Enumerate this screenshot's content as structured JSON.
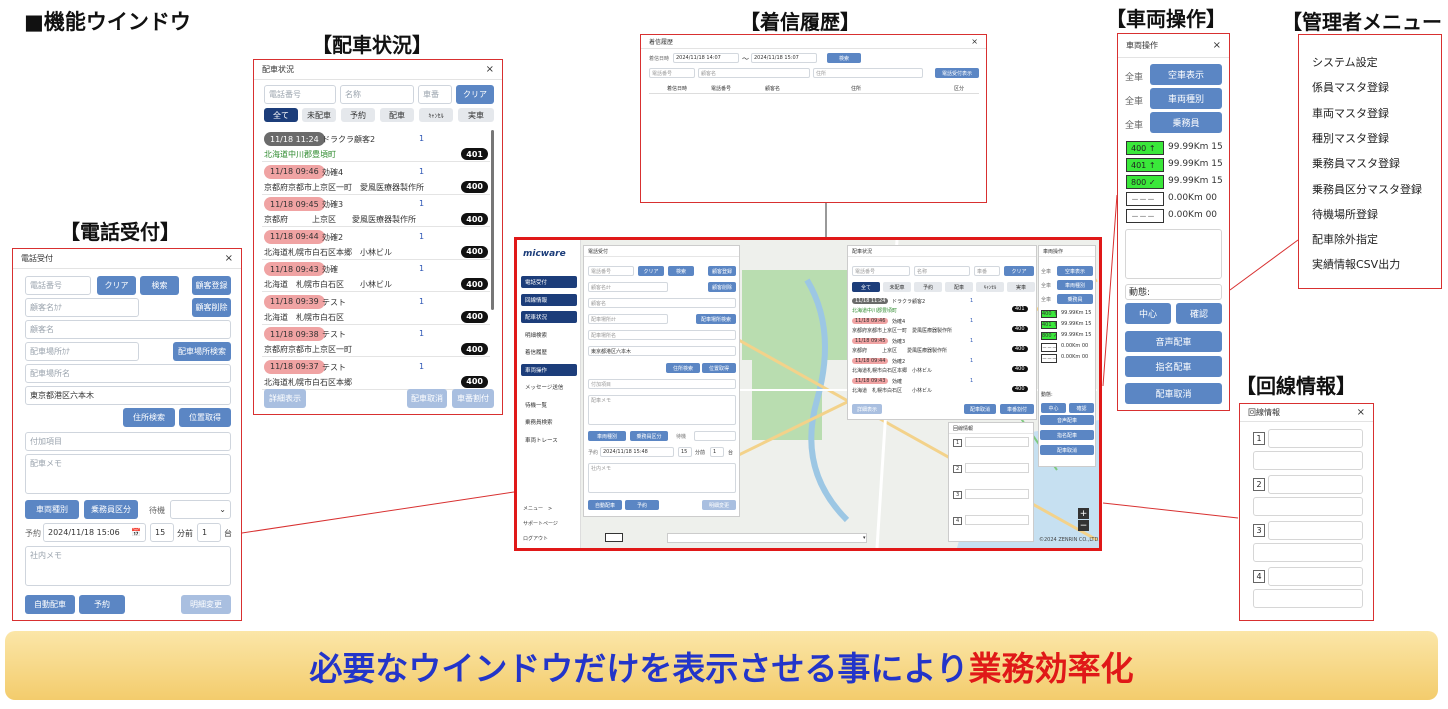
{
  "headline": "■機能ウインドウ",
  "callouts": {
    "haisha": "【配車状況】",
    "chakushin": "【着信履歴】",
    "sharyou": "【車両操作】",
    "kanri": "【管理者メニュー",
    "denwa": "【電話受付】",
    "kaisen": "【回線情報】"
  },
  "denwa": {
    "title": "電話受付",
    "close": "×",
    "phone_ph": "電話番号",
    "clear": "クリア",
    "search": "検索",
    "cust_reg": "顧客登録",
    "cust_kana_ph": "顧客名ｶﾅ",
    "cust_del": "顧客削除",
    "cust_name_ph": "顧客名",
    "place_kana_ph": "配車場所ｶﾅ",
    "place_search": "配車場所検索",
    "place_name_ph": "配車場所名",
    "address": "東京都港区六本木",
    "addr_search": "住所検索",
    "pos_get": "位置取得",
    "extra_ph": "付加項目",
    "memo_ph": "配車メモ",
    "vehicle_type": "車両種別",
    "crew_class": "乗務員区分",
    "wait_label": "待機",
    "reserve_label": "予約",
    "reserve_dt": "2024/11/18 15:06",
    "cal_icon": "📅",
    "minutes": "15",
    "min_before": "分前",
    "count": "1",
    "unit": "台",
    "internal_memo_ph": "社内メモ",
    "auto": "自動配車",
    "reserve": "予約",
    "change": "明細変更"
  },
  "haisha": {
    "title": "配車状況",
    "close": "×",
    "phone_ph": "電話番号",
    "name_ph": "名称",
    "car_ph": "車番",
    "clear": "クリア",
    "tabs": [
      "全て",
      "未配車",
      "予約",
      "配車",
      "ｷｬﾝｾﾙ",
      "実車"
    ],
    "rows": [
      {
        "time": "11/18 11:24",
        "name": "ドラクラ顧客2",
        "num": "1",
        "addr": "北海道中川郡豊頃町",
        "badge": "401"
      },
      {
        "time": "11/18 09:46",
        "name": "効確4",
        "num": "1",
        "addr": "京都府京都市上京区一町　愛風医療器製作所",
        "badge": "400"
      },
      {
        "time": "11/18 09:45",
        "name": "効確3",
        "num": "1",
        "addr": "京都府　　　上京区　　愛風医療器製作所",
        "badge": "400"
      },
      {
        "time": "11/18 09:44",
        "name": "効確2",
        "num": "1",
        "addr": "北海道札幌市白石区本郷　小林ビル",
        "badge": "400"
      },
      {
        "time": "11/18 09:43",
        "name": "効確",
        "num": "1",
        "addr": "北海道　札幌市白石区　　小林ビル",
        "badge": "400"
      },
      {
        "time": "11/18 09:39",
        "name": "テスト",
        "num": "1",
        "addr": "北海道　札幌市白石区",
        "badge": "400"
      },
      {
        "time": "11/18 09:38",
        "name": "テスト",
        "num": "1",
        "addr": "京都府京都市上京区一町",
        "badge": "400"
      },
      {
        "time": "11/18 09:37",
        "name": "テスト",
        "num": "1",
        "addr": "北海道札幌市白石区本郷",
        "badge": "400"
      }
    ],
    "detail": "詳細表示",
    "cancel": "配車取消",
    "assign": "車番割付"
  },
  "chakushin": {
    "title": "着信履歴",
    "close": "×",
    "date_label": "着信日時",
    "from": "2024/11/18 14:07",
    "tilde": "〜",
    "to": "2024/11/18 15:07",
    "search": "検索",
    "phone_ph": "電話番号",
    "cust_ph": "顧客名",
    "addr_ph": "住所",
    "accept": "電話受付表示",
    "cols": [
      "着信日時",
      "電話番号",
      "顧客名",
      "住所",
      "区分"
    ]
  },
  "sharyou": {
    "title": "車両操作",
    "close": "×",
    "all": "全車",
    "btns": [
      "空車表示",
      "車両種別",
      "乗務員"
    ],
    "vehicles": [
      {
        "tag": "400 ↑",
        "dist": "99.99Km 15"
      },
      {
        "tag": "401 ↑",
        "dist": "99.99Km 15"
      },
      {
        "tag": "800 ✓",
        "dist": "99.99Km 15"
      },
      {
        "tag": "－－－",
        "dist": "0.00Km 00"
      },
      {
        "tag": "－－－",
        "dist": "0.00Km 00"
      }
    ],
    "move_label": "動態:",
    "center": "中心",
    "confirm": "確認",
    "voice": "音声配車",
    "named": "指名配車",
    "cancel": "配車取消"
  },
  "kanri": {
    "items": [
      "システム設定",
      "係員マスタ登録",
      "車両マスタ登録",
      "種別マスタ登録",
      "乗務員マスタ登録",
      "乗務員区分マスタ登録",
      "待機場所登録",
      "配車除外指定",
      "実績情報CSV出力"
    ]
  },
  "kaisen": {
    "title": "回線情報",
    "close": "×",
    "lines": [
      "1",
      "2",
      "3",
      "4"
    ]
  },
  "app": {
    "logo": "micware",
    "nav": [
      "電話受付",
      "回線情報",
      "配車状況",
      "明細検索",
      "着信履歴",
      "車両操作",
      "メッセージ送信",
      "待機一覧",
      "乗務員検索",
      "車両トレース"
    ],
    "menu": "メニュー　>",
    "support": "サポートページ",
    "logout": "ログアウト",
    "mini_reserve": "2024/11/18 15:48",
    "mini_lines_title": "回線情報",
    "copyright": "©2024 ZENRIN CO.,LTD."
  },
  "banner": {
    "part1": "必要なウインドウだけを表示させる事により",
    "part2": "業務効率化"
  }
}
